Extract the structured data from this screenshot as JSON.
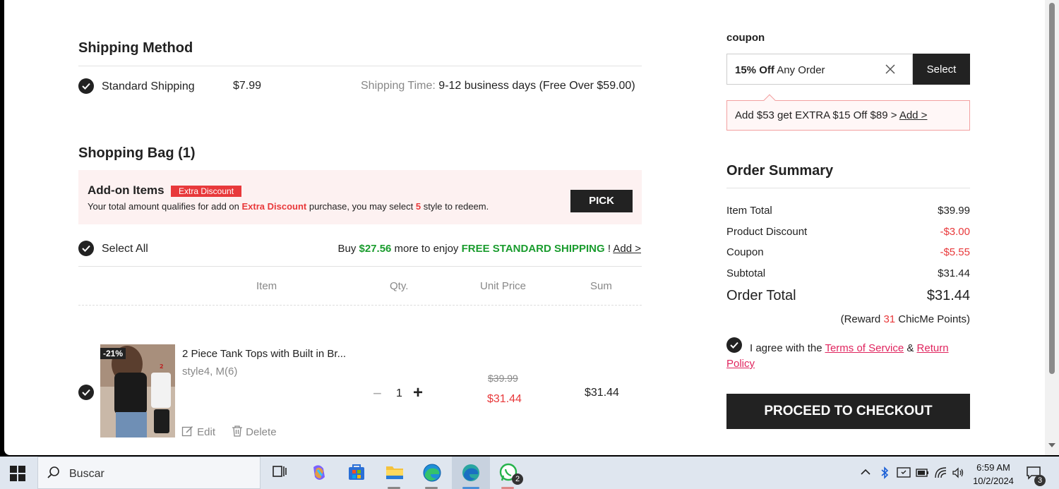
{
  "shipping": {
    "heading": "Shipping Method",
    "option_name": "Standard Shipping",
    "option_price": "$7.99",
    "time_label": "Shipping Time:",
    "time_value": "9-12 business days (Free Over $59.00)"
  },
  "bag": {
    "heading": "Shopping Bag (1)",
    "addon_title": "Add-on Items",
    "addon_badge": "Extra Discount",
    "addon_desc_1": "Your total amount qualifies for add on ",
    "addon_desc_2": "Extra Discount",
    "addon_desc_3": " purchase, you may select ",
    "addon_desc_4": "5",
    "addon_desc_5": " style to redeem.",
    "pick_label": "PICK",
    "select_all": "Select All",
    "free_ship_1": "Buy ",
    "free_ship_amount": "$27.56",
    "free_ship_2": " more to enjoy ",
    "free_ship_3": "FREE STANDARD SHIPPING",
    "free_ship_4": " ! ",
    "free_ship_link": "Add >",
    "columns": {
      "item": "Item",
      "qty": "Qty.",
      "unit_price": "Unit Price",
      "sum": "Sum"
    }
  },
  "product": {
    "discount_badge": "-21%",
    "name": "2 Piece Tank Tops with Built in Br...",
    "variant": "style4, M(6)",
    "qty": "1",
    "qty_minus": "−",
    "qty_plus": "+",
    "original_price": "$39.99",
    "price": "$31.44",
    "sum": "$31.44",
    "edit_label": "Edit",
    "delete_label": "Delete"
  },
  "coupon": {
    "label": "coupon",
    "code_bold": "15% Off",
    "code_rest": " Any Order",
    "select_label": "Select",
    "promo_text": "Add $53 get EXTRA $15 Off $89 > ",
    "promo_link": "Add >"
  },
  "summary": {
    "heading": "Order Summary",
    "item_total_label": "Item Total",
    "item_total": "$39.99",
    "product_discount_label": "Product Discount",
    "product_discount": "-$3.00",
    "coupon_label": "Coupon",
    "coupon": "-$5.55",
    "subtotal_label": "Subtotal",
    "subtotal": "$31.44",
    "order_total_label": "Order Total",
    "order_total": "$31.44",
    "reward_1": "(Reward ",
    "reward_points": "31",
    "reward_2": " ChicMe Points)",
    "agree_text": "I agree with the ",
    "terms_link": "Terms of Service",
    "amp": " & ",
    "return_link": "Return Policy",
    "checkout_label": "PROCEED TO CHECKOUT"
  },
  "colors": {
    "accent_red": "#e8393b",
    "green": "#1a9c2e",
    "dark": "#222222",
    "link_pink": "#e0245e"
  },
  "taskbar": {
    "search_placeholder": "Buscar",
    "time": "6:59 AM",
    "date": "10/2/2024",
    "whatsapp_badge": "2",
    "notification_count": "3",
    "icons": [
      "windows-start-icon",
      "search-icon",
      "task-view-icon",
      "copilot-icon",
      "microsoft-store-icon",
      "file-explorer-icon",
      "edge-icon",
      "edge-dev-icon",
      "whatsapp-icon"
    ]
  }
}
